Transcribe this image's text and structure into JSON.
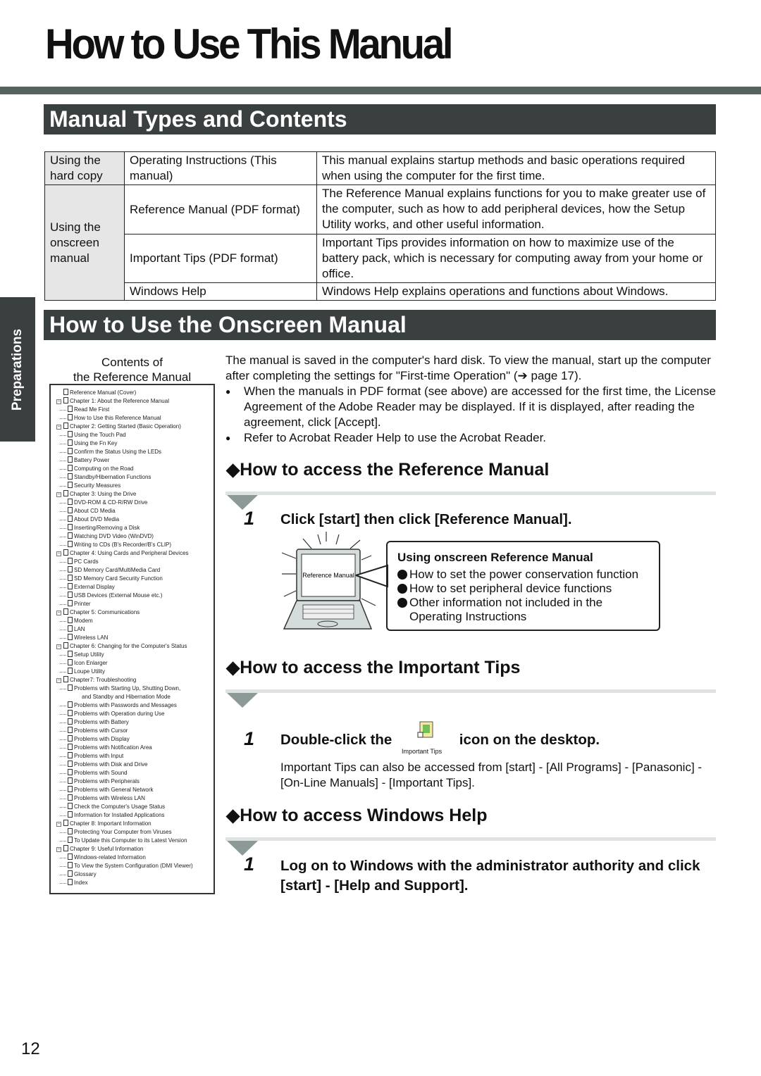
{
  "title": "How to Use This Manual",
  "side_tab": "Preparations",
  "section1": {
    "heading": "Manual Types and Contents",
    "table": [
      {
        "group": "Using the hard copy",
        "name": "Operating Instructions (This manual)",
        "desc": "This manual explains startup methods and basic operations required when using the computer for the first time."
      },
      {
        "group": "Using the onscreen manual",
        "name": "Reference Manual (PDF format)",
        "desc": "The Reference Manual explains functions for you to make greater use of the computer, such as how to add peripheral devices, how the Setup Utility works, and other useful information."
      },
      {
        "group": "",
        "name": "Important Tips (PDF format)",
        "desc": "Important Tips provides information on how to maximize use of the battery pack, which is necessary for computing away from your home or office."
      },
      {
        "group": "",
        "name": "Windows Help",
        "desc": "Windows Help explains operations and functions about Windows."
      }
    ]
  },
  "section2": {
    "heading": "How to Use the Onscreen Manual",
    "caption_line1": "Contents of",
    "caption_line2": "the Reference Manual",
    "intro": "The manual is saved in the computer's hard disk.  To view the manual, start up the computer after completing the settings for \"First-time Operation\" (➔ page 17).",
    "bullets": [
      "When the manuals in PDF format (see above) are accessed for the first time, the License Agreement of the Adobe Reader may be displayed. If it is displayed, after reading the agreement, click [Accept].",
      "Refer to Acrobat Reader Help to use the Acrobat Reader."
    ],
    "tree": [
      {
        "label": "Reference Manual (Cover)",
        "children": []
      },
      {
        "label": "Chapter 1: About the Reference Manual",
        "children": [
          "Read Me First",
          "How to Use this Reference Manual"
        ]
      },
      {
        "label": "Chapter 2: Getting Started (Basic Operation)",
        "children": [
          "Using the Touch Pad",
          "Using the Fn Key",
          "Confirm the Status Using the LEDs",
          "Battery Power",
          "Computing on the Road",
          "Standby/Hibernation Functions",
          "Security Measures"
        ]
      },
      {
        "label": "Chapter 3: Using the Drive",
        "children": [
          "DVD-ROM & CD-R/RW Drive",
          "About CD Media",
          "About DVD Media",
          "Inserting/Removing a Disk",
          "Watching DVD Video (WinDVD)",
          "Writing to CDs (B's Recorder/B's CLIP)"
        ]
      },
      {
        "label": "Chapter 4: Using Cards and Peripheral Devices",
        "children": [
          "PC Cards",
          "SD Memory Card/MultiMedia Card",
          "SD Memory Card Security Function",
          "External Display",
          "USB Devices (External Mouse etc.)",
          "Printer"
        ]
      },
      {
        "label": "Chapter 5: Communications",
        "children": [
          "Modem",
          "LAN",
          "Wireless LAN"
        ]
      },
      {
        "label": "Chapter 6: Changing for the Computer's Status",
        "children": [
          "Setup Utility",
          "Icon Enlarger",
          "Loupe Utility"
        ]
      },
      {
        "label": "Chapter7: Troubleshooting",
        "children": [
          "Problems with Starting Up, Shutting Down,|and Standby and Hibernation Mode",
          "Problems with Passwords and Messages",
          "Problems with Operation during Use",
          "Problems with Battery",
          "Problems with Cursor",
          "Problems with Display",
          "Problems with Notification Area",
          "Problems with Input",
          "Problems with Disk and Drive",
          "Problems with Sound",
          "Problems with Peripherals",
          "Problems with General Network",
          "Problems with Wireless LAN",
          "Check the Computer's Usage Status",
          "Information for Installed Applications"
        ]
      },
      {
        "label": "Chapter 8: Important Information",
        "children": [
          "Protecting Your Computer from Viruses",
          "To Update this Computer to its Latest Version"
        ]
      },
      {
        "label": "Chapter 9: Useful Information",
        "children": [
          "Windows-related Information",
          "To View the System Configuration (DMI Viewer)",
          "Glossary",
          "Index"
        ]
      }
    ],
    "ref": {
      "heading": "◆How to access the Reference Manual",
      "step_num": "1",
      "step": "Click [start] then click [Reference Manual].",
      "screen_label": "Reference Manual",
      "callout_title": "Using onscreen Reference Manual",
      "callout_items": [
        "How to set the power conservation function",
        "How to set peripheral device functions",
        "Other information not included in the Operating Instructions"
      ]
    },
    "tips": {
      "heading": "◆How to access the Important Tips",
      "step_num": "1",
      "step_before": "Double-click the",
      "icon_label": "Important Tips",
      "step_after": "icon on the desktop.",
      "note": "Important Tips can also be accessed from [start] - [All Programs] - [Panasonic] - [On-Line Manuals] - [Important Tips]."
    },
    "help": {
      "heading": "◆How to access Windows Help",
      "step_num": "1",
      "step": "Log on to Windows with the administrator authority and click [start] - [Help and Support]."
    }
  },
  "page_number": "12",
  "colors": {
    "header_bg": "#3a3f40",
    "top_bar": "#56625f",
    "triangle": "#8c9997"
  }
}
